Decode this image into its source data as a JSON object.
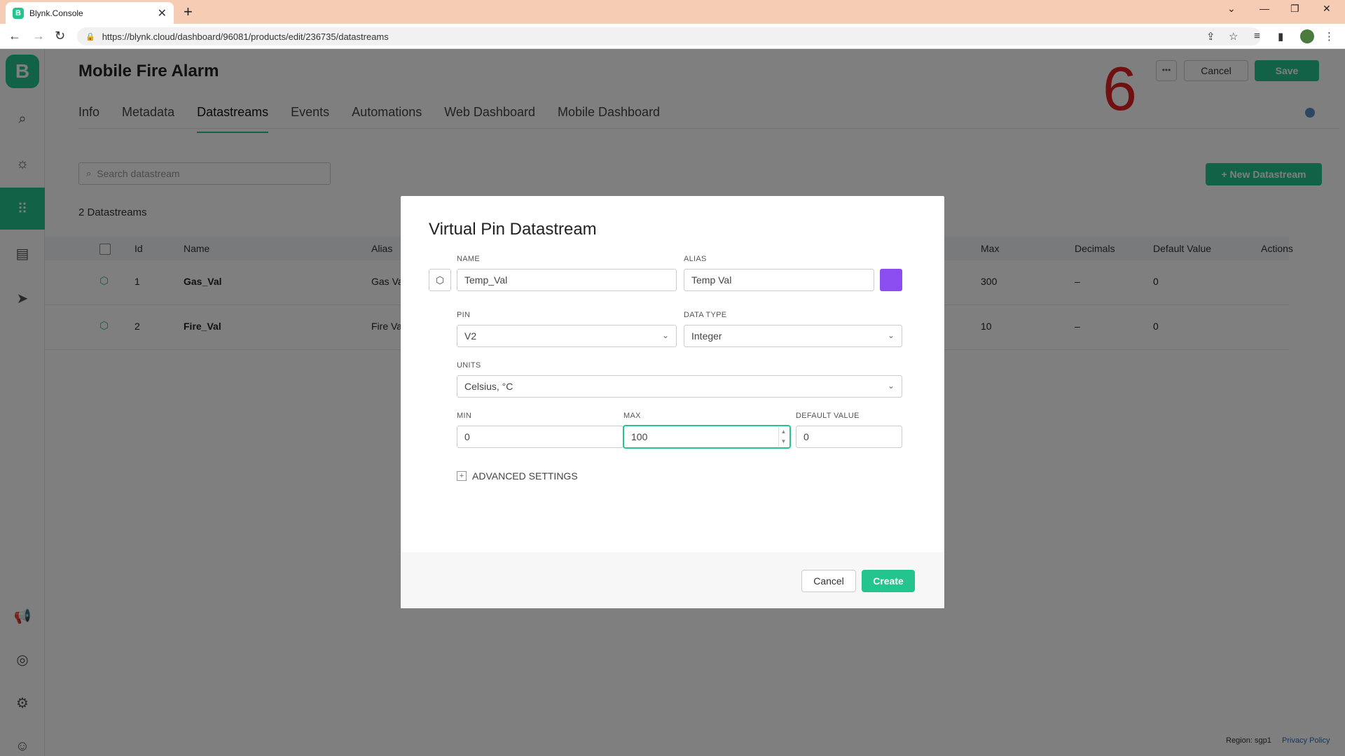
{
  "browser": {
    "tab_title": "Blynk.Console",
    "favicon_letter": "B",
    "url": "https://blynk.cloud/dashboard/96081/products/edit/236735/datastreams"
  },
  "app": {
    "logo_letter": "B",
    "page_title": "Mobile Fire Alarm",
    "step_number": "6",
    "header": {
      "more_label": "•••",
      "cancel_label": "Cancel",
      "save_label": "Save"
    },
    "tabs": [
      "Info",
      "Metadata",
      "Datastreams",
      "Events",
      "Automations",
      "Web Dashboard",
      "Mobile Dashboard"
    ],
    "active_tab": "Datastreams",
    "search_placeholder": "Search datastream",
    "new_datastream_label": "+ New Datastream",
    "datastream_count": "2 Datastreams",
    "table": {
      "headers": {
        "id": "Id",
        "name": "Name",
        "alias": "Alias",
        "max": "Max",
        "decimals": "Decimals",
        "default_value": "Default Value",
        "actions": "Actions"
      },
      "rows": [
        {
          "id": "1",
          "name": "Gas_Val",
          "alias": "Gas Va",
          "max": "300",
          "decimals": "–",
          "default": "0"
        },
        {
          "id": "2",
          "name": "Fire_Val",
          "alias": "Fire Va",
          "max": "10",
          "decimals": "–",
          "default": "0"
        }
      ]
    },
    "footer": {
      "region": "Region: sgp1",
      "privacy": "Privacy Policy"
    }
  },
  "modal": {
    "title": "Virtual Pin Datastream",
    "name_label": "NAME",
    "name_value": "Temp_Val",
    "alias_label": "ALIAS",
    "alias_value": "Temp Val",
    "color": "#8c4df0",
    "pin_label": "PIN",
    "pin_value": "V2",
    "data_type_label": "DATA TYPE",
    "data_type_value": "Integer",
    "units_label": "UNITS",
    "units_value": "Celsius, °C",
    "min_label": "MIN",
    "min_value": "0",
    "max_label": "MAX",
    "max_value": "100",
    "default_label": "DEFAULT VALUE",
    "default_value": "0",
    "advanced_label": "ADVANCED SETTINGS",
    "cancel_label": "Cancel",
    "create_label": "Create"
  },
  "colors": {
    "accent": "#23c48e",
    "step_number": "#e02020",
    "overlay": "rgba(0,0,0,0.5)"
  }
}
